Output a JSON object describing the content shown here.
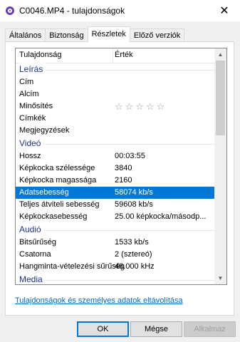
{
  "window": {
    "title": "C0046.MP4 - tulajdonságok",
    "close_glyph": "✕"
  },
  "tabs": [
    {
      "label": "Általános"
    },
    {
      "label": "Biztonság"
    },
    {
      "label": "Részletek"
    },
    {
      "label": "Előző verziók"
    }
  ],
  "active_tab": "Részletek",
  "list": {
    "header": {
      "property": "Tulajdonság",
      "value": "Érték"
    },
    "groups": {
      "description": "Leírás",
      "video": "Videó",
      "audio": "Audió",
      "media": "Media"
    },
    "description_rows": [
      {
        "key": "Cím",
        "value": ""
      },
      {
        "key": "Alcím",
        "value": ""
      },
      {
        "key": "Minősítés",
        "value": "☆☆☆☆☆"
      },
      {
        "key": "Címkék",
        "value": ""
      },
      {
        "key": "Megjegyzések",
        "value": ""
      }
    ],
    "video_rows": [
      {
        "key": "Hossz",
        "value": "00:03:55"
      },
      {
        "key": "Képkocka szélessége",
        "value": "3840"
      },
      {
        "key": "Képkocka magassága",
        "value": "2160"
      },
      {
        "key": "Adatsebesség",
        "value": "58074 kb/s"
      },
      {
        "key": "Teljes átviteli sebesség",
        "value": "59608 kb/s"
      },
      {
        "key": "Képkockasebesség",
        "value": "25.00 képkocka/másodp..."
      }
    ],
    "audio_rows": [
      {
        "key": "Bitsűrűség",
        "value": "1533 kb/s"
      },
      {
        "key": "Csatorna",
        "value": "2 (sztereó)"
      },
      {
        "key": "Hangminta-vételezési sűrűség",
        "value": "48.000 kHz"
      }
    ],
    "selected_row": "Adatsebesség",
    "rating_stars": 0
  },
  "remove_link": "Tulajdonságok és személyes adatok eltávolítása",
  "buttons": {
    "ok": "OK",
    "cancel": "Mégse",
    "apply": "Alkalmaz"
  },
  "colors": {
    "selection": "#0078d7",
    "group_heading": "#1e3287",
    "link": "#0066cc"
  }
}
